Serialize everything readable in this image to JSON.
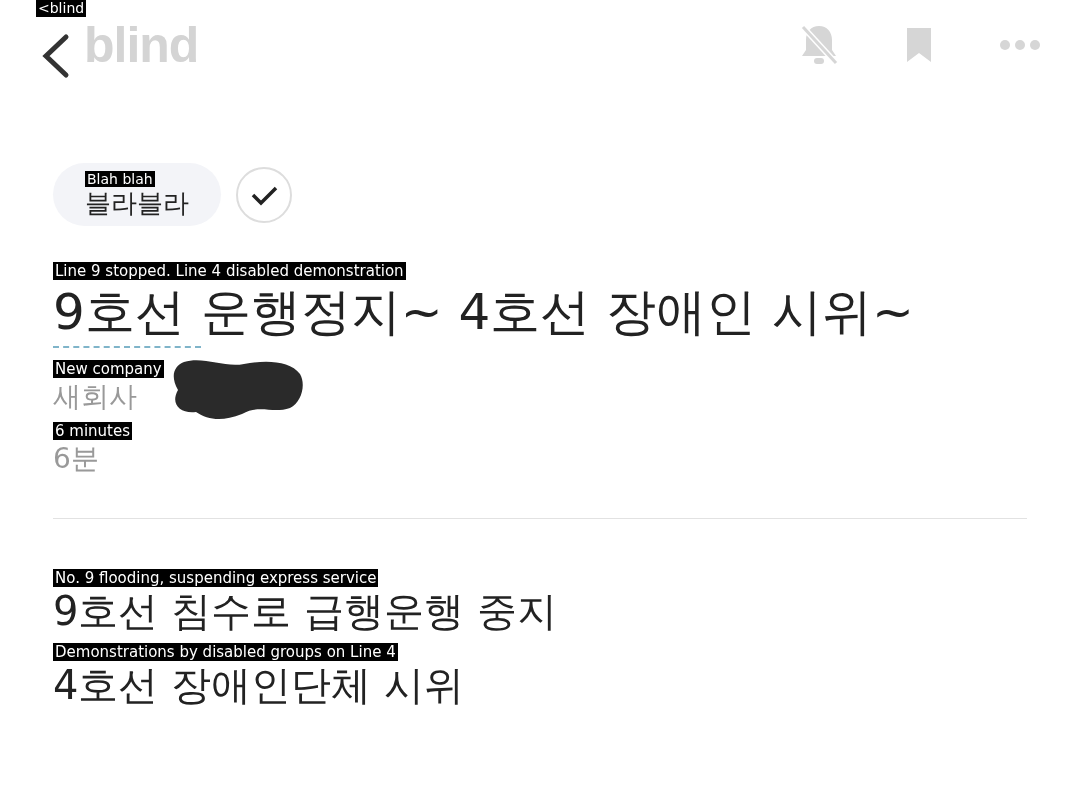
{
  "header": {
    "logo": "blind",
    "back_translation": "<blind"
  },
  "tag": {
    "label": "블라블라",
    "translation": "Blah blah",
    "checked": true
  },
  "post": {
    "title": "9호선 운행정지~ 4호선 장애인 시위~",
    "title_translation": "Line 9 stopped. Line 4 disabled demonstration",
    "company": "새회사",
    "company_translation": "New company",
    "time": "6분",
    "time_translation": "6 minutes",
    "body": [
      {
        "text": "9호선 침수로 급행운행 중지",
        "translation": "No. 9 flooding, suspending express service"
      },
      {
        "text": "4호선 장애인단체 시위",
        "translation": "Demonstrations by disabled groups on Line 4"
      }
    ]
  }
}
